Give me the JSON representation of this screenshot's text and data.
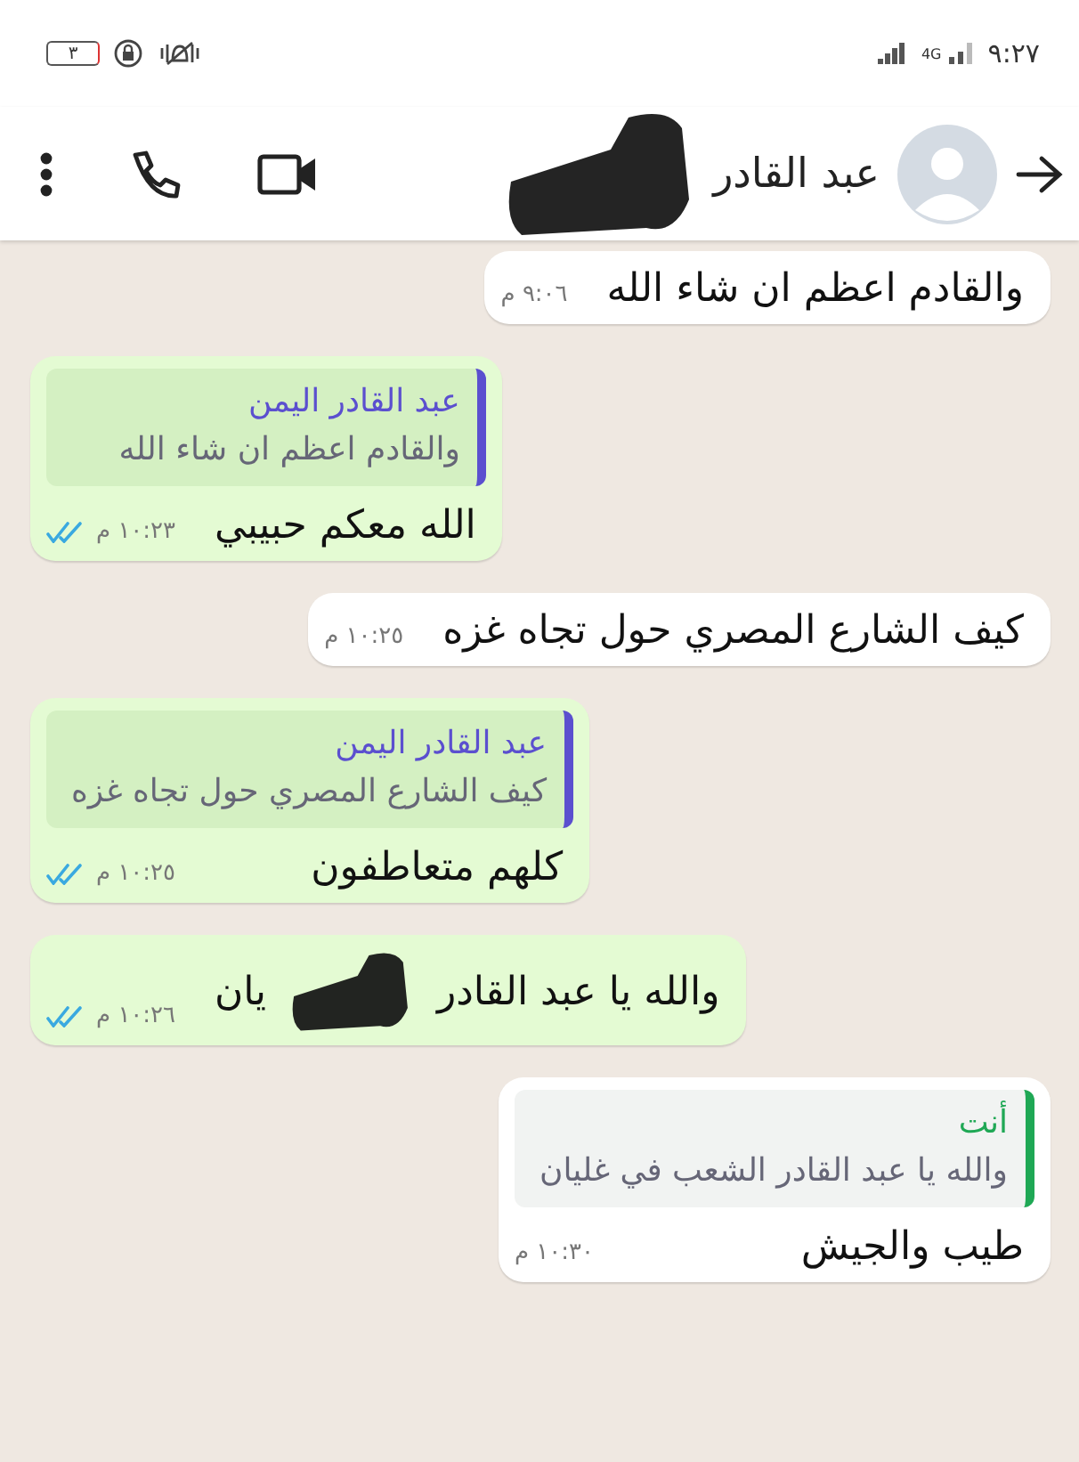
{
  "status_bar": {
    "time": "٩:٢٧",
    "network": "4G",
    "battery": "٣"
  },
  "header": {
    "contact_name": "عبد القادر",
    "redacted": true
  },
  "messages": [
    {
      "kind": "incoming",
      "text": "والقادم اعظم ان شاء الله",
      "time": "٩:٠٦ م"
    },
    {
      "kind": "outgoing",
      "quote": {
        "author": "عبد القادر اليمن",
        "text": "والقادم اعظم ان شاء الله",
        "color": "#5b4fcf"
      },
      "text": "الله معكم حبيبي",
      "time": "١٠:٢٣ م",
      "read": true
    },
    {
      "kind": "incoming",
      "text": "كيف الشارع المصري حول تجاه غزه",
      "time": "١٠:٢٥ م"
    },
    {
      "kind": "outgoing",
      "quote": {
        "author": "عبد القادر اليمن",
        "text": "كيف الشارع المصري حول تجاه غزه",
        "color": "#5b4fcf"
      },
      "text": "كلهم متعاطفون",
      "time": "١٠:٢٥ م",
      "read": true
    },
    {
      "kind": "outgoing",
      "text": "والله يا عبد القادر",
      "redacted": true,
      "tail_text": "يان",
      "time": "١٠:٢٦ م",
      "read": true
    },
    {
      "kind": "incoming",
      "quote": {
        "author": "أنت",
        "text": "والله يا عبد القادر الشعب في غليان",
        "color": "#1fa855"
      },
      "text": "طيب والجيش",
      "time": "١٠:٣٠ م"
    }
  ]
}
